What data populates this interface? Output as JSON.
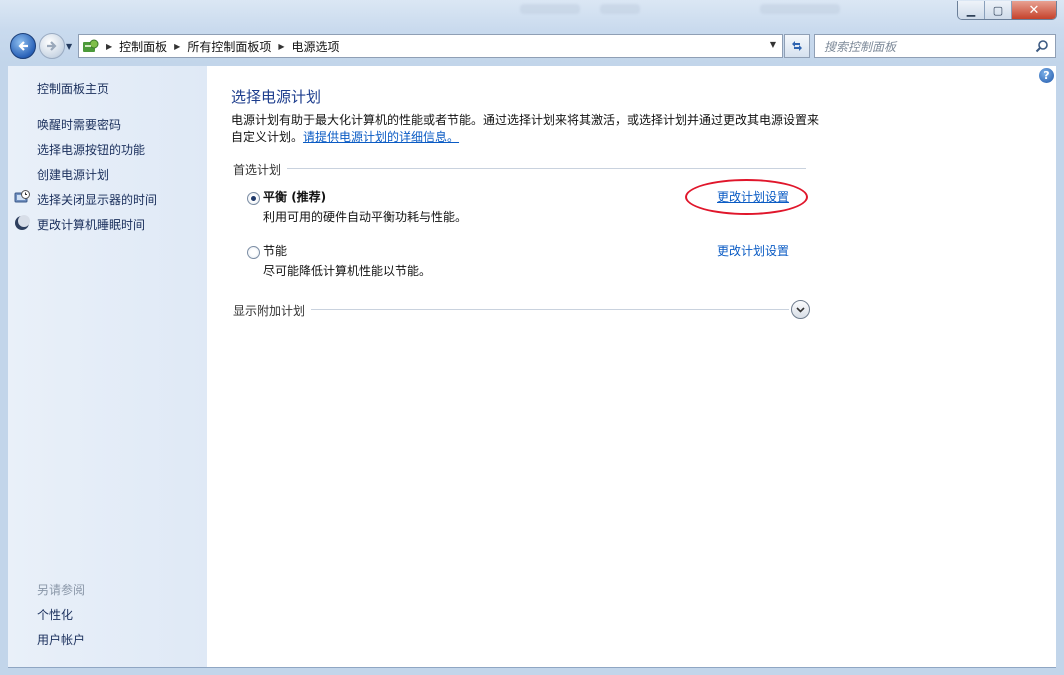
{
  "window": {
    "minimize": "▁",
    "maximize": "▢",
    "close": "✕"
  },
  "nav": {
    "breadcrumb": [
      "控制面板",
      "所有控制面板项",
      "电源选项"
    ],
    "search_placeholder": "搜索控制面板"
  },
  "sidebar": {
    "home": "控制面板主页",
    "links": [
      {
        "label": "唤醒时需要密码",
        "icon": ""
      },
      {
        "label": "选择电源按钮的功能",
        "icon": ""
      },
      {
        "label": "创建电源计划",
        "icon": ""
      },
      {
        "label": "选择关闭显示器的时间",
        "icon": "monitor-clock-icon"
      },
      {
        "label": "更改计算机睡眠时间",
        "icon": "moon-icon"
      }
    ],
    "see_also_title": "另请参阅",
    "see_also": [
      "个性化",
      "用户帐户"
    ]
  },
  "main": {
    "title": "选择电源计划",
    "description": "电源计划有助于最大化计算机的性能或者节能。通过选择计划来将其激活，或选择计划并通过更改其电源设置来自定义计划。",
    "description_link": "请提供电源计划的详细信息。",
    "preferred_label": "首选计划",
    "plans": [
      {
        "name": "平衡",
        "tag": " (推荐)",
        "desc": "利用可用的硬件自动平衡功耗与性能。",
        "selected": true,
        "change": "更改计划设置"
      },
      {
        "name": "节能",
        "tag": "",
        "desc": "尽可能降低计算机性能以节能。",
        "selected": false,
        "change": "更改计划设置"
      }
    ],
    "more_plans_label": "显示附加计划",
    "help": "?"
  },
  "colors": {
    "link": "#0a5bc4",
    "title": "#1d3d8d",
    "annotation": "#e0162b"
  }
}
